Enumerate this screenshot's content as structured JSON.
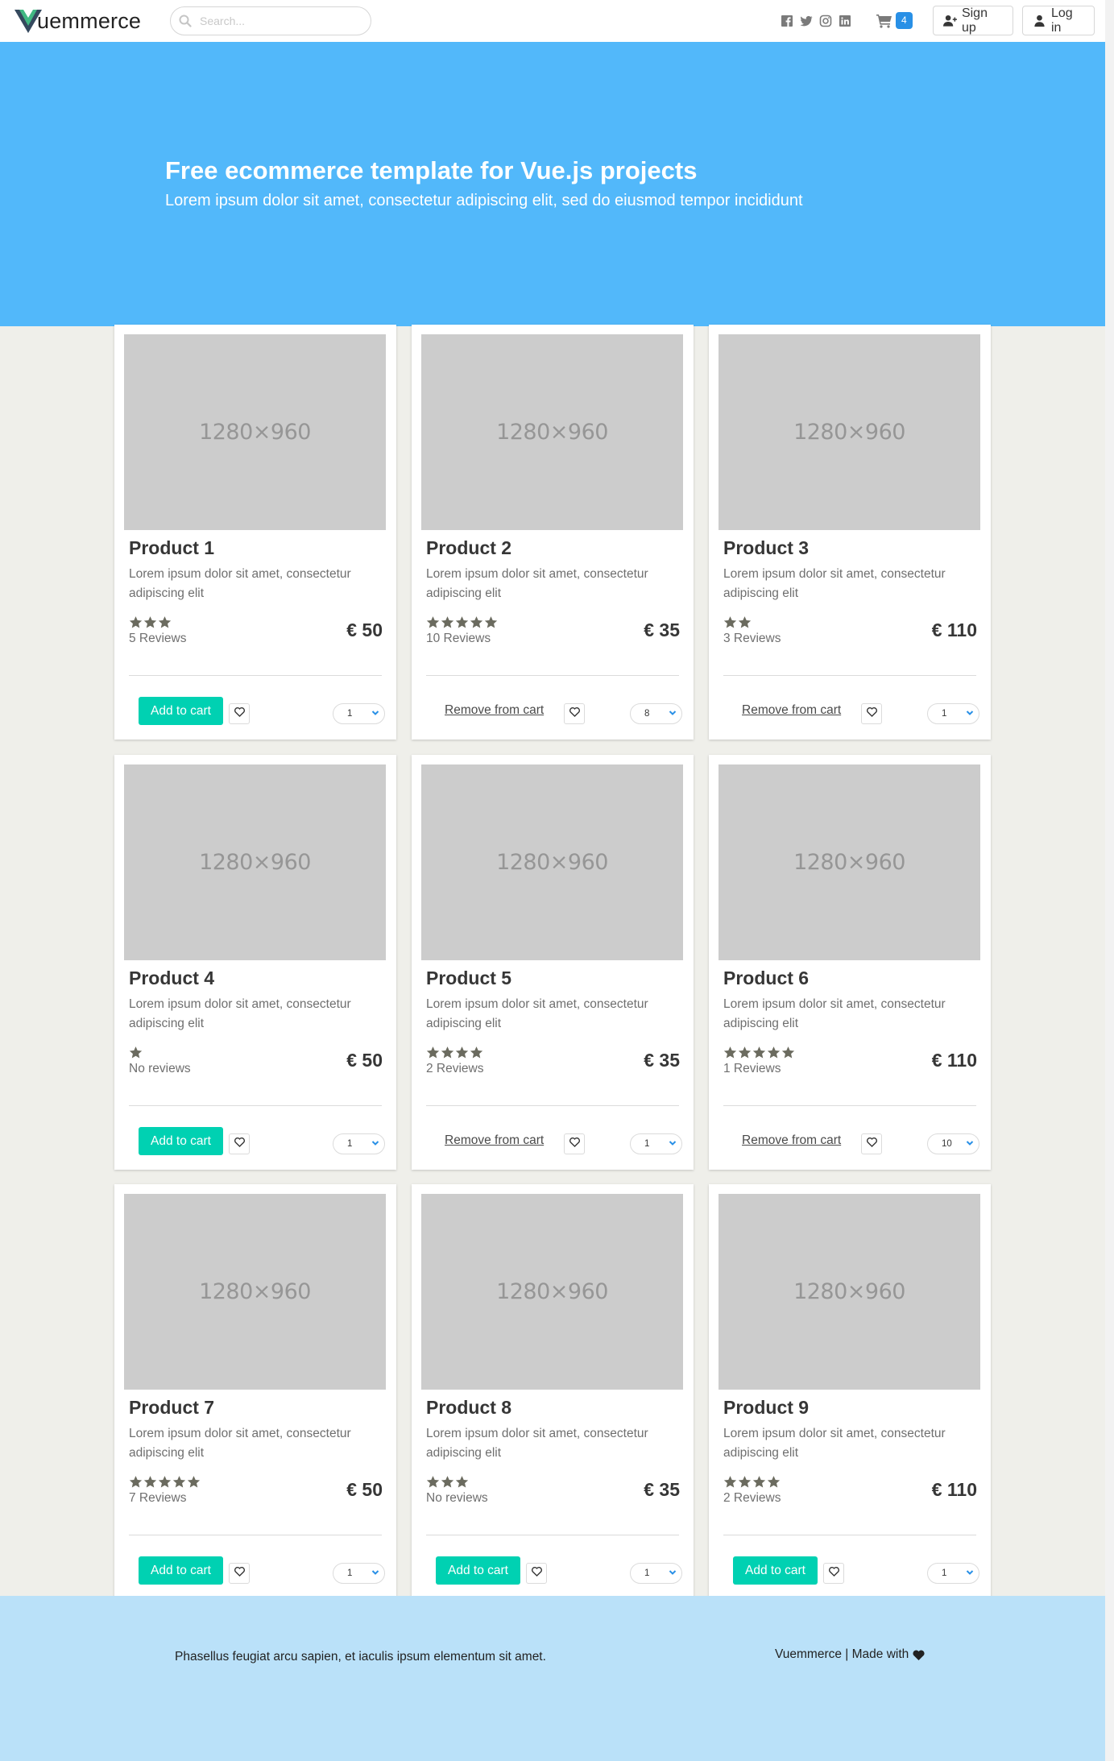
{
  "brand": {
    "name": "uemmerce",
    "logo_letter": "V",
    "colors": {
      "logo_dark": "#35495e",
      "logo_green": "#41b883"
    }
  },
  "search": {
    "placeholder": "Search...",
    "value": ""
  },
  "social_icons": [
    "facebook-icon",
    "twitter-icon",
    "instagram-icon",
    "linkedin-icon"
  ],
  "cart": {
    "count": "4",
    "badge_color": "#2990e6"
  },
  "auth": {
    "signup_label": "Sign up",
    "login_label": "Log in"
  },
  "hero": {
    "title": "Free ecommerce template for Vue.js projects",
    "subtitle": "Lorem ipsum dolor sit amet, consectetur adipiscing elit, sed do eiusmod tempor incididunt",
    "background": "#52b8fa"
  },
  "products": [
    {
      "title": "Product 1",
      "image_label": "1280×960",
      "description": "Lorem ipsum dolor sit amet, consectetur adipiscing elit",
      "rating": 3,
      "reviews": "5 Reviews",
      "price": "€ 50",
      "in_cart": false,
      "action_label": "Add to cart",
      "quantity": "1"
    },
    {
      "title": "Product 2",
      "image_label": "1280×960",
      "description": "Lorem ipsum dolor sit amet, consectetur adipiscing elit",
      "rating": 5,
      "reviews": "10 Reviews",
      "price": "€ 35",
      "in_cart": true,
      "action_label": "Remove from cart",
      "quantity": "8"
    },
    {
      "title": "Product 3",
      "image_label": "1280×960",
      "description": "Lorem ipsum dolor sit amet, consectetur adipiscing elit",
      "rating": 2,
      "reviews": "3 Reviews",
      "price": "€ 110",
      "in_cart": true,
      "action_label": "Remove from cart",
      "quantity": "1"
    },
    {
      "title": "Product 4",
      "image_label": "1280×960",
      "description": "Lorem ipsum dolor sit amet, consectetur adipiscing elit",
      "rating": 1,
      "reviews": "No reviews",
      "price": "€ 50",
      "in_cart": false,
      "action_label": "Add to cart",
      "quantity": "1"
    },
    {
      "title": "Product 5",
      "image_label": "1280×960",
      "description": "Lorem ipsum dolor sit amet, consectetur adipiscing elit",
      "rating": 4,
      "reviews": "2 Reviews",
      "price": "€ 35",
      "in_cart": true,
      "action_label": "Remove from cart",
      "quantity": "1"
    },
    {
      "title": "Product 6",
      "image_label": "1280×960",
      "description": "Lorem ipsum dolor sit amet, consectetur adipiscing elit",
      "rating": 5,
      "reviews": "1 Reviews",
      "price": "€ 110",
      "in_cart": true,
      "action_label": "Remove from cart",
      "quantity": "10"
    },
    {
      "title": "Product 7",
      "image_label": "1280×960",
      "description": "Lorem ipsum dolor sit amet, consectetur adipiscing elit",
      "rating": 5,
      "reviews": "7 Reviews",
      "price": "€ 50",
      "in_cart": false,
      "action_label": "Add to cart",
      "quantity": "1"
    },
    {
      "title": "Product 8",
      "image_label": "1280×960",
      "description": "Lorem ipsum dolor sit amet, consectetur adipiscing elit",
      "rating": 3,
      "reviews": "No reviews",
      "price": "€ 35",
      "in_cart": false,
      "action_label": "Add to cart",
      "quantity": "1"
    },
    {
      "title": "Product 9",
      "image_label": "1280×960",
      "description": "Lorem ipsum dolor sit amet, consectetur adipiscing elit",
      "rating": 4,
      "reviews": "2 Reviews",
      "price": "€ 110",
      "in_cart": false,
      "action_label": "Add to cart",
      "quantity": "1"
    }
  ],
  "footer": {
    "left_text": "Phasellus feugiat arcu sapien, et iaculis ipsum elementum sit amet.",
    "right_text": "Vuemmerce | Made with",
    "right_icon": "heart-icon",
    "background": "#bae1f9"
  }
}
